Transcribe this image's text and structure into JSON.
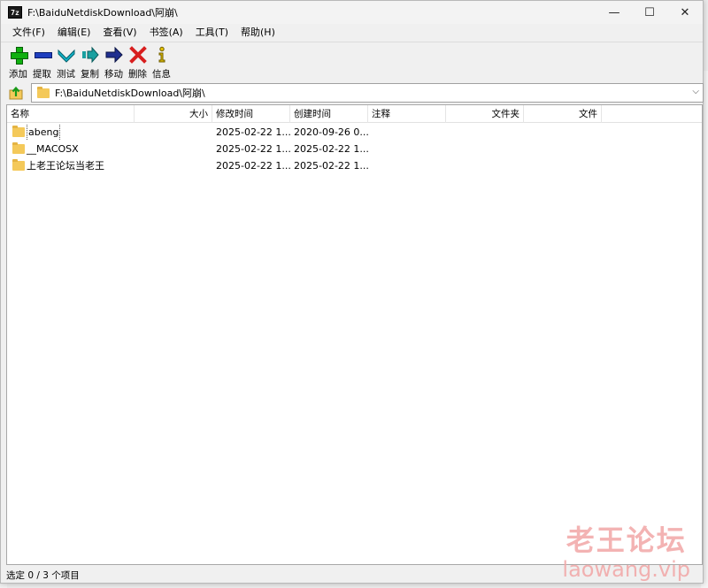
{
  "window": {
    "title": "F:\\BaiduNetdiskDownload\\阿崩\\",
    "app_icon_text": "7z",
    "controls": {
      "minimize": "—",
      "maximize": "☐",
      "close": "✕"
    }
  },
  "menu": [
    "文件(F)",
    "编辑(E)",
    "查看(V)",
    "书签(A)",
    "工具(T)",
    "帮助(H)"
  ],
  "toolbar": [
    {
      "label": "添加",
      "icon": "add-icon",
      "color": "#10b010"
    },
    {
      "label": "提取",
      "icon": "extract-icon",
      "color": "#1f3fbf"
    },
    {
      "label": "测试",
      "icon": "test-icon",
      "color": "#13b3c8"
    },
    {
      "label": "复制",
      "icon": "copy-icon",
      "color": "#1aa0a0"
    },
    {
      "label": "移动",
      "icon": "move-icon",
      "color": "#1f2f8f"
    },
    {
      "label": "删除",
      "icon": "delete-icon",
      "color": "#d81e1e"
    },
    {
      "label": "信息",
      "icon": "info-icon",
      "color": "#e6c200"
    }
  ],
  "address": {
    "path": "F:\\BaiduNetdiskDownload\\阿崩\\"
  },
  "columns": [
    "名称",
    "大小",
    "修改时间",
    "创建时间",
    "注释",
    "文件夹",
    "文件"
  ],
  "rows": [
    {
      "name": "abeng",
      "modified": "2025-02-22 1...",
      "created": "2020-09-26 0..."
    },
    {
      "name": "__MACOSX",
      "modified": "2025-02-22 1...",
      "created": "2025-02-22 1..."
    },
    {
      "name": "上老王论坛当老王",
      "modified": "2025-02-22 1...",
      "created": "2025-02-22 1..."
    }
  ],
  "status": "选定 0 / 3 个项目",
  "watermark": {
    "cn": "老王论坛",
    "en": "laowang.vip"
  }
}
